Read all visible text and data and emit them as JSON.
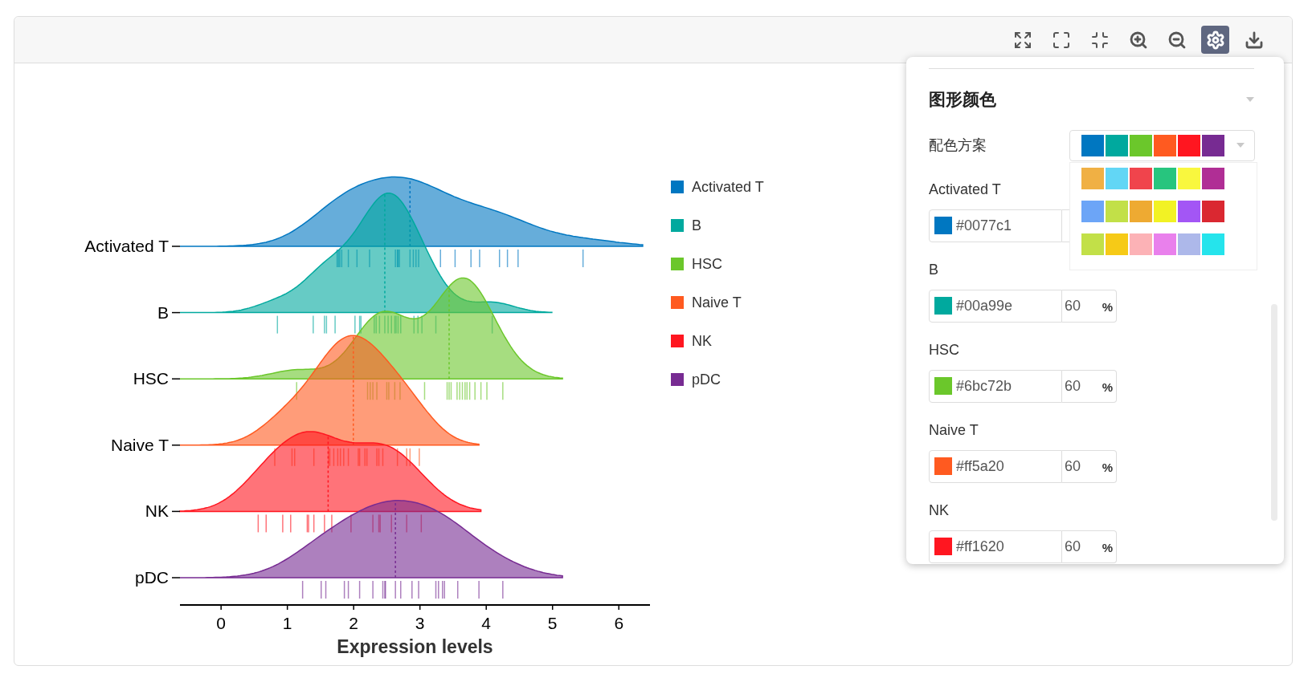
{
  "toolbar": [
    {
      "kind": "expand",
      "selected": false
    },
    {
      "kind": "fullscreen",
      "selected": false
    },
    {
      "kind": "compress",
      "selected": false
    },
    {
      "kind": "zoom_in",
      "selected": false
    },
    {
      "kind": "zoom_out",
      "selected": false
    },
    {
      "kind": "settings",
      "selected": true
    },
    {
      "kind": "download",
      "selected": false
    }
  ],
  "chart": {
    "rows": [
      {
        "label": "Activated T",
        "color": "#0077c1"
      },
      {
        "label": "B",
        "color": "#00a99e"
      },
      {
        "label": "HSC",
        "color": "#6bc72b"
      },
      {
        "label": "Naive T",
        "color": "#ff5a20"
      },
      {
        "label": "NK",
        "color": "#ff1620"
      },
      {
        "label": "pDC",
        "color": "#772b92"
      }
    ],
    "x_ticks": [
      "0",
      "1",
      "2",
      "3",
      "4",
      "5",
      "6"
    ],
    "x_title": "Expression levels",
    "legend": [
      {
        "label": "Activated T",
        "color": "#0077c1"
      },
      {
        "label": "B",
        "color": "#00a99e"
      },
      {
        "label": "HSC",
        "color": "#6bc72b"
      },
      {
        "label": "Naive T",
        "color": "#ff5a20"
      },
      {
        "label": "NK",
        "color": "#ff1620"
      },
      {
        "label": "pDC",
        "color": "#772b92"
      }
    ]
  },
  "settings": {
    "section_title": "图形颜色",
    "scheme_label": "配色方案",
    "scheme": {
      "swatches": [
        {
          "color": "#0077c1"
        },
        {
          "color": "#00a99e"
        },
        {
          "color": "#6bc72b"
        },
        {
          "color": "#ff5a20"
        },
        {
          "color": "#ff1620"
        },
        {
          "color": "#772b92"
        }
      ]
    },
    "scheme_options": [
      {
        "swatches": [
          {
            "color": "#f0b044"
          },
          {
            "color": "#62d6f5"
          },
          {
            "color": "#f0444c"
          },
          {
            "color": "#27c57e"
          },
          {
            "color": "#f9f73e"
          },
          {
            "color": "#b02e95"
          }
        ]
      },
      {
        "swatches": [
          {
            "color": "#6ca5f7"
          },
          {
            "color": "#c2e048"
          },
          {
            "color": "#eeaa32"
          },
          {
            "color": "#f2f224"
          },
          {
            "color": "#a356f5"
          },
          {
            "color": "#da2831"
          }
        ]
      },
      {
        "swatches": [
          {
            "color": "#c2e048"
          },
          {
            "color": "#f6ca17"
          },
          {
            "color": "#fcb2b6"
          },
          {
            "color": "#e980ec"
          },
          {
            "color": "#adb8ea"
          },
          {
            "color": "#25e4ec"
          }
        ]
      }
    ],
    "series": [
      {
        "label": "Activated T",
        "color": "#0077c1",
        "hex": "#0077c1"
      },
      {
        "label": "B",
        "color": "#00a99e",
        "hex": "#00a99e",
        "opacity": "60",
        "unit": "%"
      },
      {
        "label": "HSC",
        "color": "#6bc72b",
        "hex": "#6bc72b",
        "opacity": "60",
        "unit": "%"
      },
      {
        "label": "Naive T",
        "color": "#ff5a20",
        "hex": "#ff5a20",
        "opacity": "60",
        "unit": "%"
      },
      {
        "label": "NK",
        "color": "#ff1620",
        "hex": "#ff1620",
        "opacity": "60",
        "unit": "%"
      }
    ]
  }
}
